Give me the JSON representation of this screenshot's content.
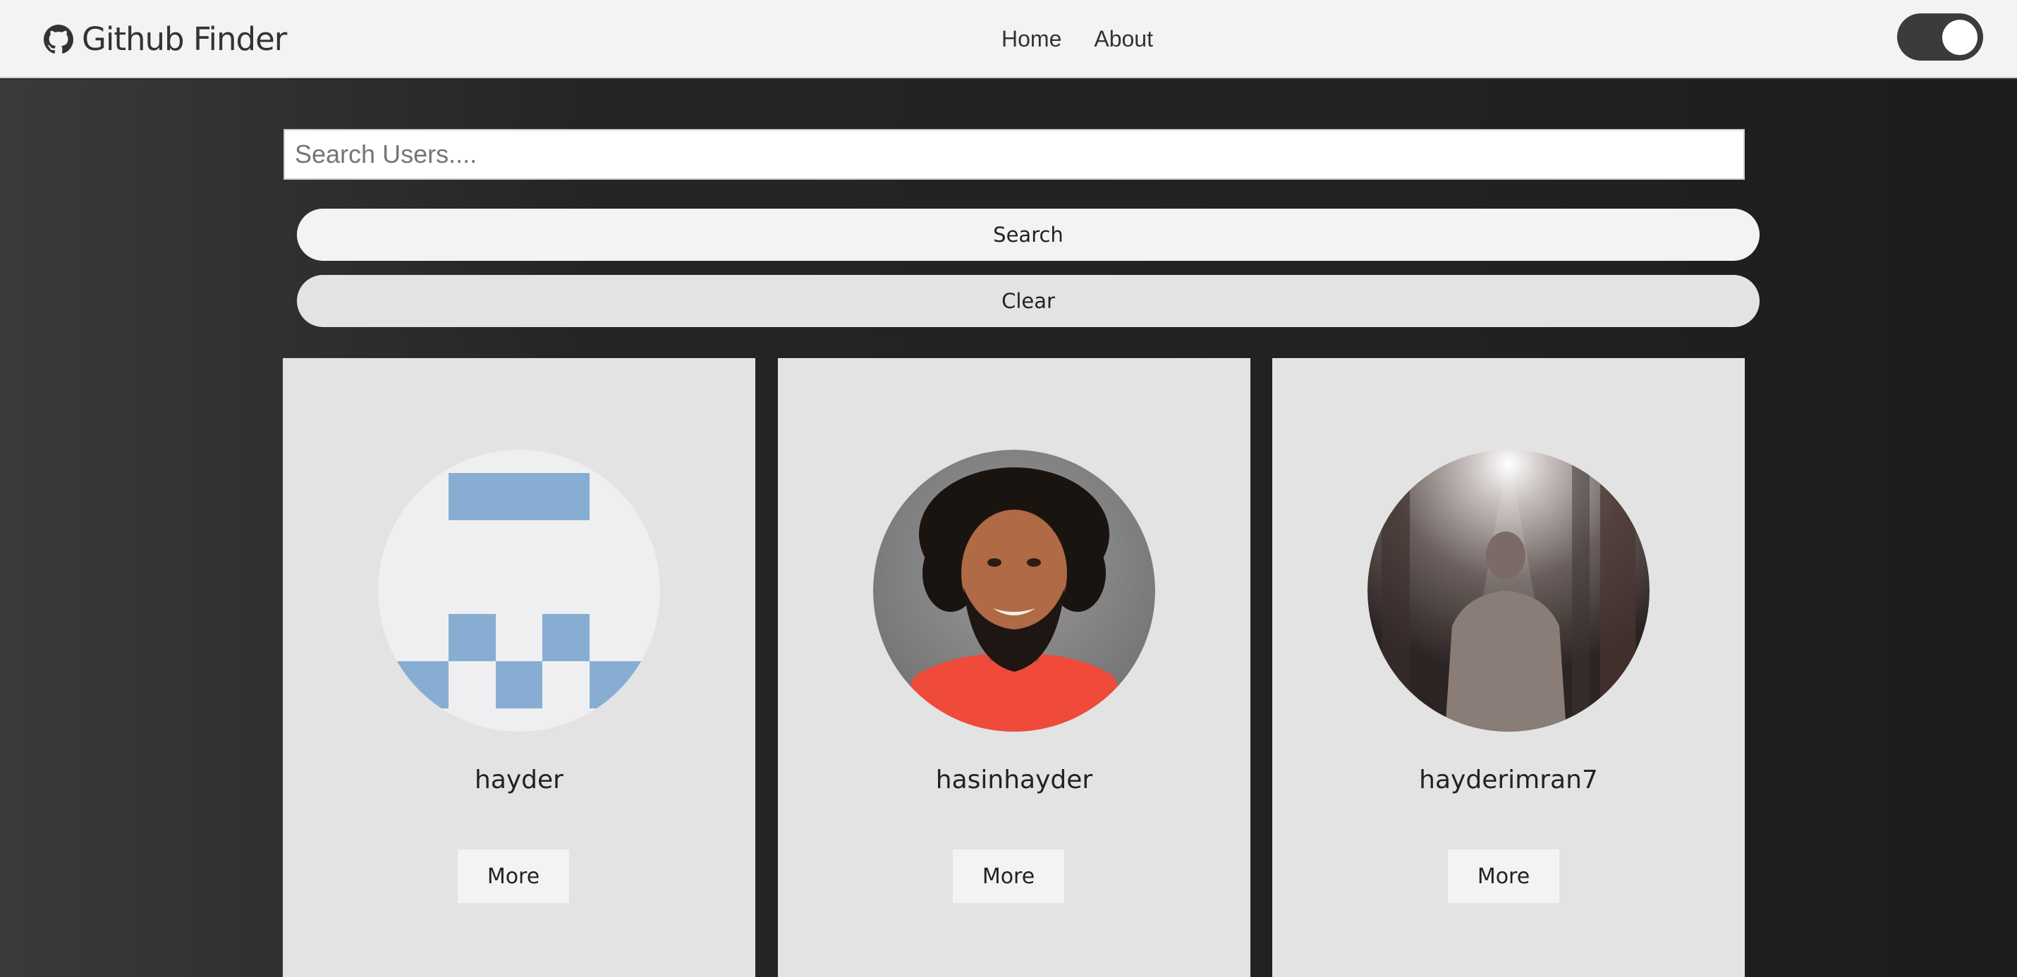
{
  "navbar": {
    "brand": "Github Finder",
    "links": [
      {
        "label": "Home"
      },
      {
        "label": "About"
      }
    ],
    "theme_toggle_state": "on"
  },
  "search": {
    "placeholder": "Search Users....",
    "value": "",
    "search_label": "Search",
    "clear_label": "Clear"
  },
  "users": [
    {
      "login": "hayder",
      "button": "More",
      "avatar": "identicon-avatar"
    },
    {
      "login": "hasinhayder",
      "button": "More",
      "avatar": "photo-avatar"
    },
    {
      "login": "hayderimran7",
      "button": "More",
      "avatar": "photo-avatar"
    }
  ],
  "colors": {
    "navbar_bg": "#f3f3f3",
    "page_bg": "#2a2a2a",
    "card_bg": "#e3e3e3",
    "identicon_blue": "#87aed2",
    "toggle_bg": "#3b3b3b"
  }
}
